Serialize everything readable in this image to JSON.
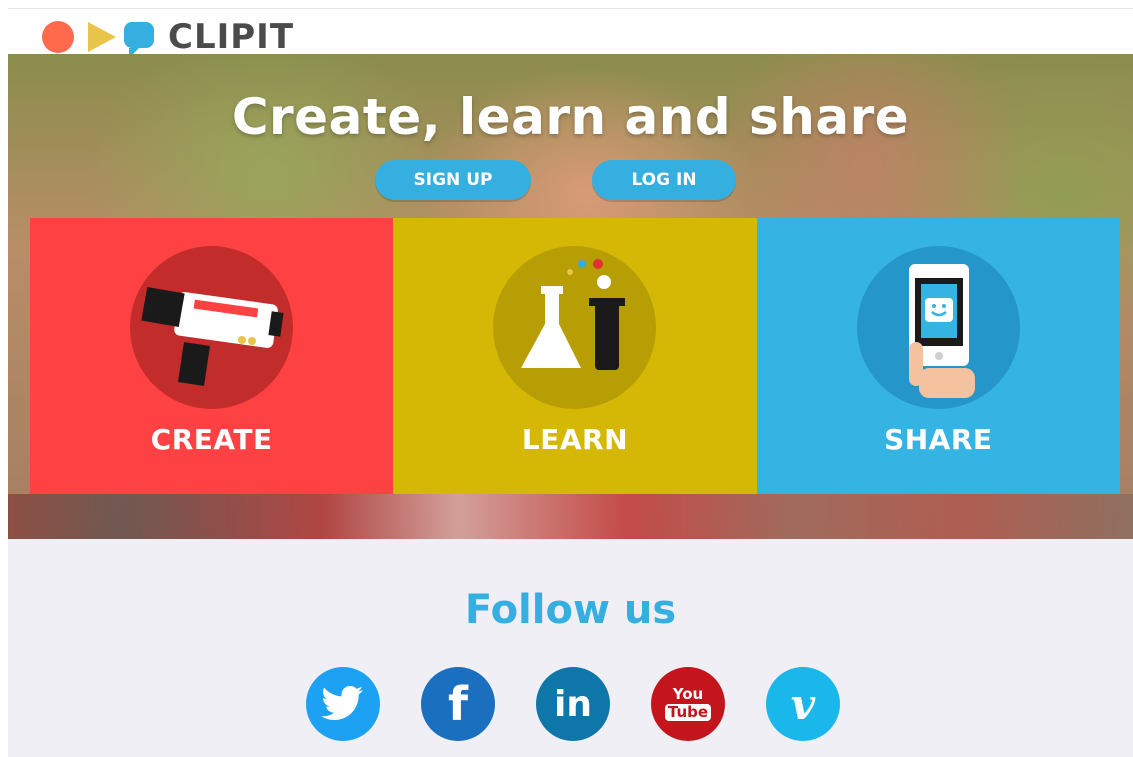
{
  "header": {
    "brand_name": "CLIPIT",
    "logo_icons": [
      "red-dot-icon",
      "yellow-play-icon",
      "blue-speech-bubble-icon"
    ]
  },
  "hero": {
    "title": "Create, learn and share",
    "signup_label": "SIGN UP",
    "login_label": "LOG IN"
  },
  "tiles": [
    {
      "label": "CREATE",
      "icon": "video-camera-icon",
      "color": "#fe4244"
    },
    {
      "label": "LEARN",
      "icon": "lab-flask-icon",
      "color": "#d4b805"
    },
    {
      "label": "SHARE",
      "icon": "smartphone-share-icon",
      "color": "#35b3e3"
    }
  ],
  "follow": {
    "title": "Follow us",
    "networks": [
      {
        "name": "twitter-icon",
        "color": "#1da1f2"
      },
      {
        "name": "facebook-icon",
        "glyph": "f",
        "color": "#1a6fbe"
      },
      {
        "name": "linkedin-icon",
        "glyph": "in",
        "color": "#0e76a8"
      },
      {
        "name": "youtube-icon",
        "glyph_top": "You",
        "glyph_bottom": "Tube",
        "color": "#c4151c"
      },
      {
        "name": "vimeo-icon",
        "glyph": "v",
        "color": "#1ab7ea"
      }
    ]
  }
}
